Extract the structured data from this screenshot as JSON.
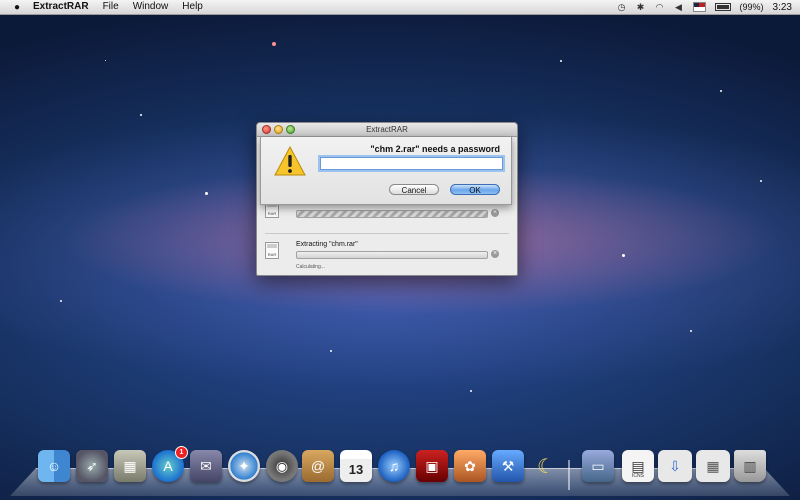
{
  "menubar": {
    "app_name": "ExtractRAR",
    "menus": [
      "File",
      "Window",
      "Help"
    ],
    "battery": "(99%)",
    "clock": "3:23"
  },
  "window": {
    "title": "ExtractRAR"
  },
  "sheet": {
    "message": "\"chm 2.rar\" needs a password",
    "password_value": "",
    "cancel_label": "Cancel",
    "ok_label": "OK"
  },
  "jobs": [
    {
      "file_icon_text": "RAR",
      "label": "",
      "status": ""
    },
    {
      "file_icon_text": "RAR",
      "label": "Extracting \"chm.rar\"",
      "status": "Calculating..."
    }
  ],
  "dock": {
    "calendar_day": "13",
    "app_store_badge": "1",
    "icns_label": "ICNS"
  }
}
